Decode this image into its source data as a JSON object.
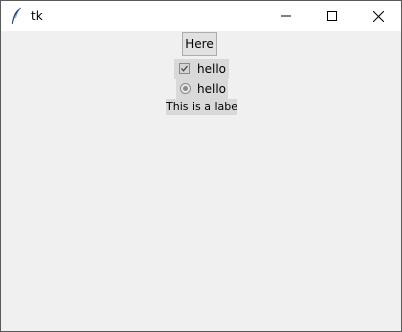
{
  "window": {
    "title": "tk",
    "icon": "feather-icon",
    "controls": {
      "minimize": "minimize-icon",
      "maximize": "maximize-icon",
      "close": "close-icon"
    }
  },
  "widgets": {
    "button_label": "Here",
    "checkbutton_label": "hello",
    "checkbutton_checked": true,
    "radiobutton_label": "hello",
    "radiobutton_selected": true,
    "label_text": "This is a label"
  },
  "colors": {
    "window_bg": "#f0f0f0",
    "widget_bg": "#d9d9d9",
    "titlebar_bg": "#ffffff"
  }
}
